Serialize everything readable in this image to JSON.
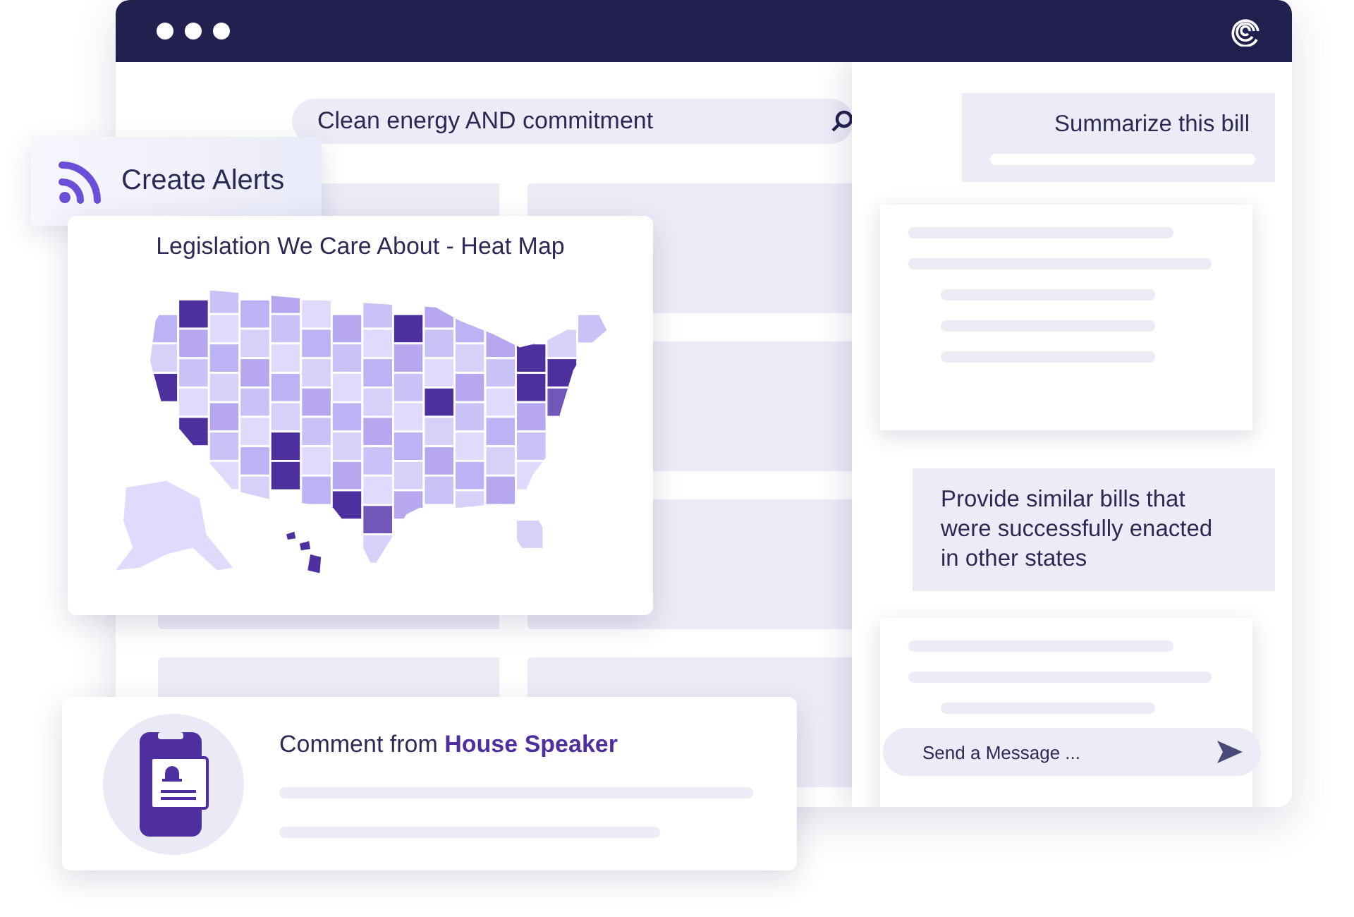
{
  "search": {
    "value": "Clean energy AND commitment"
  },
  "alert_button": {
    "label": "Create Alerts"
  },
  "heat_map": {
    "title": "Legislation We Care About - Heat Map"
  },
  "comment": {
    "text": "Comment from **House Speaker**"
  },
  "chat": {
    "messages": [
      {
        "kind": "prompt",
        "text": "Summarize this bill"
      },
      {
        "kind": "response"
      },
      {
        "kind": "prompt",
        "text": "Provide similar bills that were successfully enacted in other states"
      },
      {
        "kind": "response"
      }
    ],
    "input": {
      "placeholder": "Send a Message ..."
    }
  }
}
